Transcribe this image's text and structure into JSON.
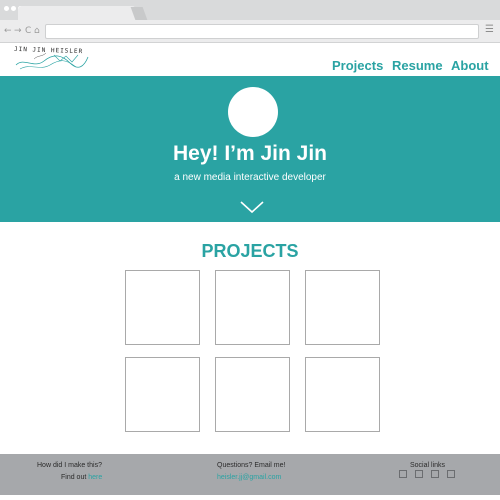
{
  "browser": {
    "nav_buttons": [
      "←",
      "→",
      "C",
      "⌂"
    ],
    "menu_glyph": "☰"
  },
  "site": {
    "logo_text": "JIN JIN HEISLER",
    "nav": [
      "Projects",
      "Resume",
      "About"
    ]
  },
  "hero": {
    "title": "Hey! I’m Jin Jin",
    "subtitle": "a new media interactive developer"
  },
  "projects": {
    "heading": "PROJECTS"
  },
  "footer": {
    "col1_title": "How did I make this?",
    "col1_prefix": "Find out ",
    "col1_link": "here",
    "col2_title": "Questions? Email me!",
    "col2_email": "heisler.jj@gmail.com",
    "col3_title": "Social links"
  },
  "colors": {
    "accent": "#2aa3a3",
    "footer_bg": "#a6a8ab",
    "chrome_bg": "#d9dadb"
  }
}
